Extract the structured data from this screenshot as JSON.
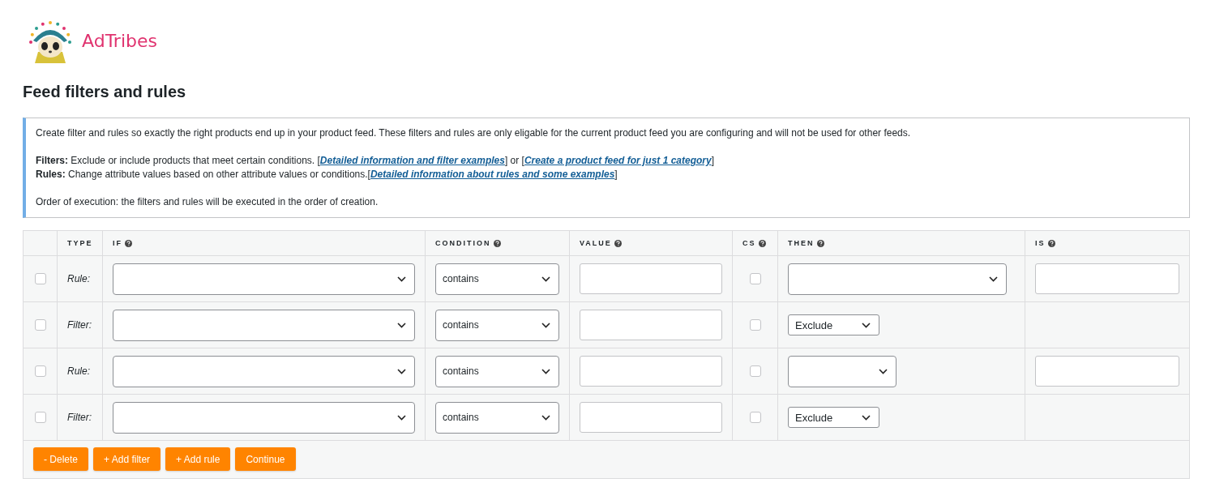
{
  "brand": "AdTribes",
  "title": "Feed filters and rules",
  "info": {
    "intro": "Create filter and rules so exactly the right products end up in your product feed. These filters and rules are only eligable for the current product feed you are configuring and will not be used for other feeds.",
    "filters_label": "Filters:",
    "filters_text": "Exclude or include products that meet certain conditions. [",
    "filters_link1": "Detailed information and filter examples",
    "filters_mid": "] or [",
    "filters_link2": "Create a product feed for just 1 category",
    "filters_end": "]",
    "rules_label": "Rules:",
    "rules_text": "Change attribute values based on other attribute values or conditions.[",
    "rules_link": "Detailed information about rules and some examples",
    "rules_end": "]",
    "order": "Order of execution: the filters and rules will be executed in the order of creation."
  },
  "columns": [
    {
      "label": "TYPE",
      "help": false
    },
    {
      "label": "IF",
      "help": true
    },
    {
      "label": "CONDITION",
      "help": true
    },
    {
      "label": "VALUE",
      "help": true
    },
    {
      "label": "CS",
      "help": true
    },
    {
      "label": "THEN",
      "help": true
    },
    {
      "label": "IS",
      "help": true
    }
  ],
  "rows": [
    {
      "kind": "rule",
      "checked": false,
      "type": "Rule:",
      "condition": "contains",
      "cs": false,
      "then": {
        "kind": "select",
        "wide": true
      }
    },
    {
      "kind": "filter",
      "checked": false,
      "type": "Filter:",
      "condition": "contains",
      "cs": false,
      "then": {
        "kind": "action",
        "value": "Exclude",
        "wide": false
      }
    },
    {
      "kind": "rule",
      "checked": false,
      "type": "Rule:",
      "condition": "contains",
      "cs": false,
      "then": {
        "kind": "select",
        "wide": false
      }
    },
    {
      "kind": "filter",
      "checked": false,
      "type": "Filter:",
      "condition": "contains",
      "cs": false,
      "then": {
        "kind": "action",
        "value": "Exclude",
        "wide": false
      }
    }
  ],
  "buttons": [
    "- Delete",
    "+ Add filter",
    "+ Add rule",
    "Continue"
  ]
}
